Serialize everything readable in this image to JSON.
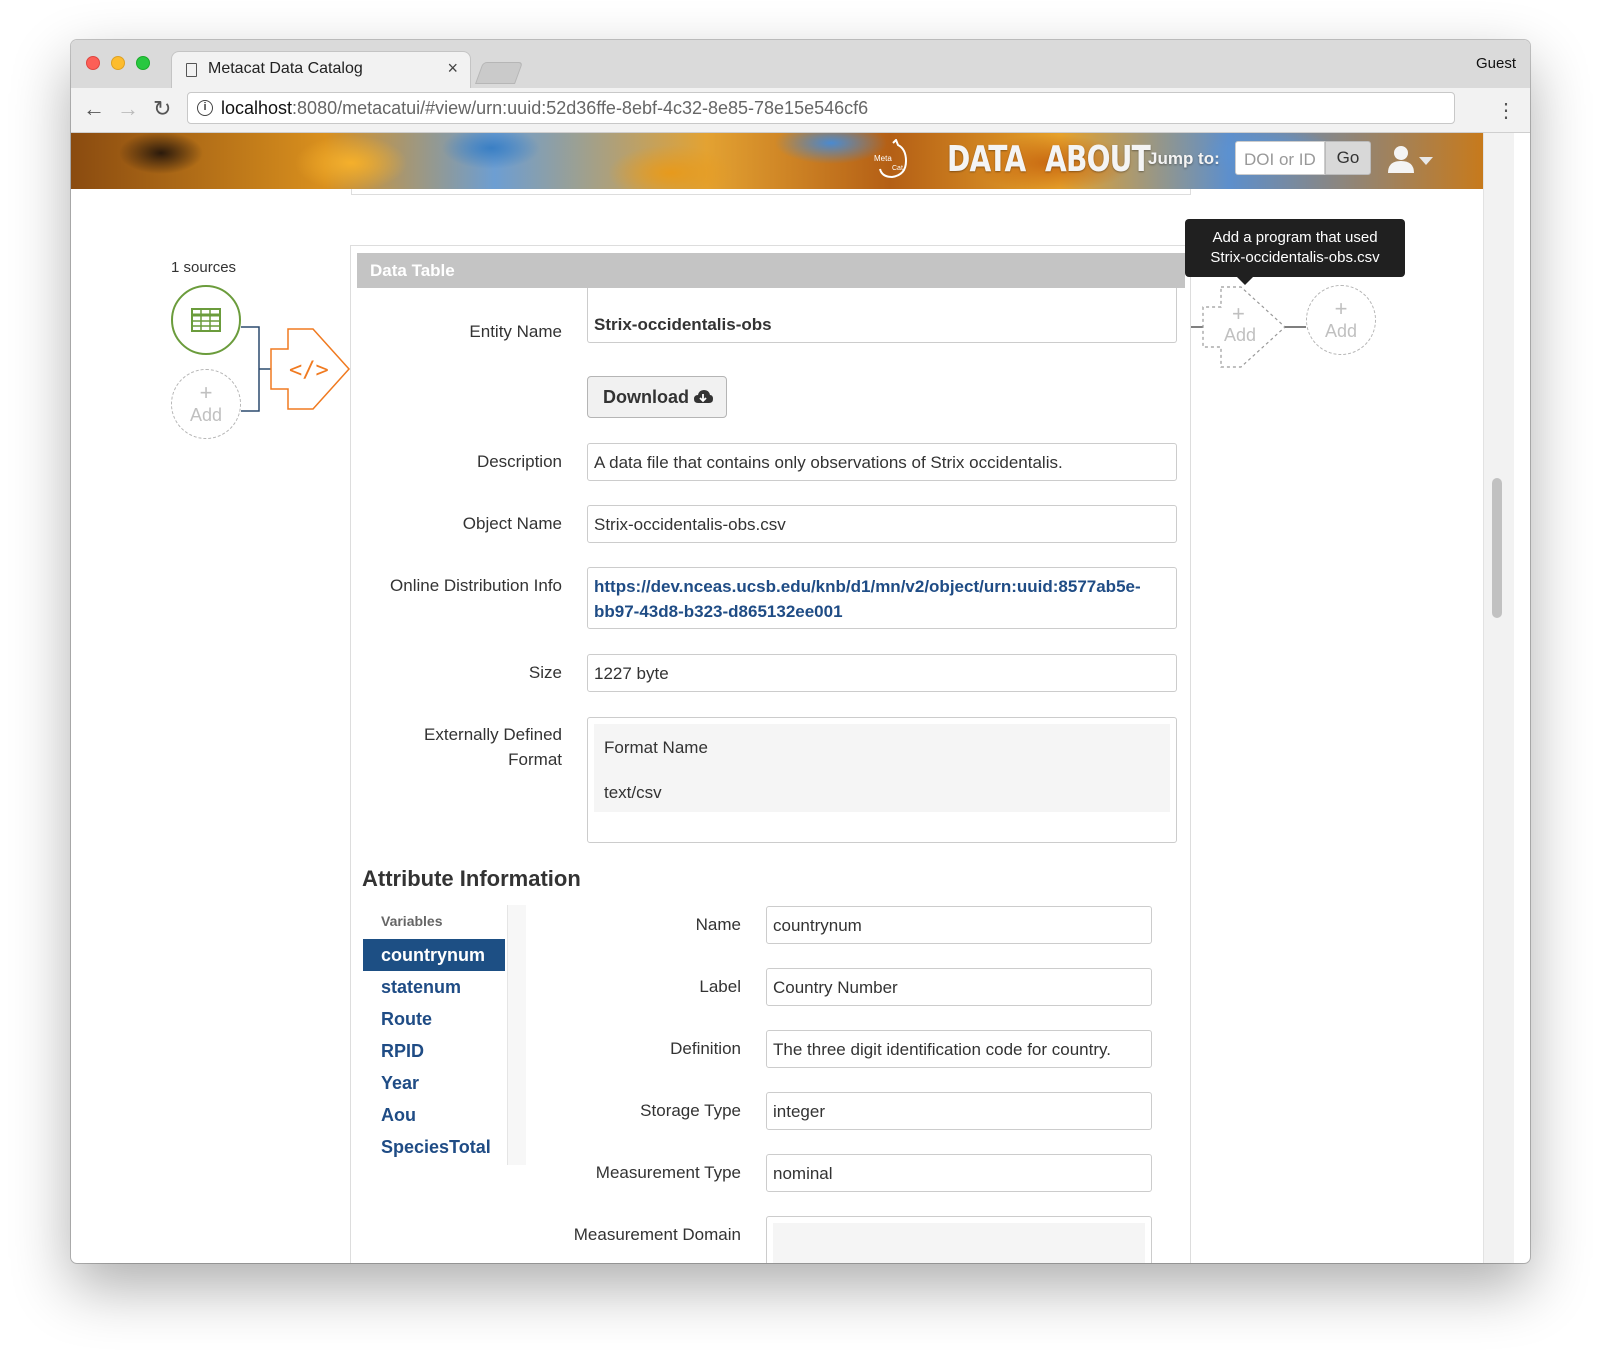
{
  "browser": {
    "tab_title": "Metacat Data Catalog",
    "tab_close": "×",
    "profile": "Guest",
    "url_host": "localhost",
    "url_rest": ":8080/metacatui/#view/urn:uuid:52d36ffe-8ebf-4c32-8e85-78e15e546cf6",
    "back": "←",
    "forward": "→",
    "reload": "↻",
    "menu": "⋮"
  },
  "header": {
    "logo_top": "Meta",
    "logo_bottom": "Cat",
    "nav": [
      "DATA",
      "ABOUT"
    ],
    "jump_label": "Jump to:",
    "jump_placeholder": "DOI or ID",
    "go_label": "Go"
  },
  "provenance": {
    "sources_label": "1 sources",
    "add_label": "Add",
    "add_plus": "+",
    "tooltip_line1": "Add a program that used",
    "tooltip_line2": "Strix-occidentalis-obs.csv",
    "program_glyph": "</>",
    "colors": {
      "source": "#6b9c3c",
      "program": "#f07a20"
    }
  },
  "data_table": {
    "header": "Data Table",
    "download_label": "Download",
    "fields": [
      {
        "label": "Entity Name",
        "value": "Strix-occidentalis-obs"
      },
      {
        "label": "Description",
        "value": "A data file that contains only observations of Strix occidentalis."
      },
      {
        "label": "Object Name",
        "value": "Strix-occidentalis-obs.csv"
      },
      {
        "label": "Online Distribution Info",
        "value_line1": "https://dev.nceas.ucsb.edu/knb/d1/mn/v2/object/urn:uuid:8577ab5e-",
        "value_line2": "bb97-43d8-b323-d865132ee001"
      },
      {
        "label": "Size",
        "value": "1227 byte"
      },
      {
        "label_line1": "Externally Defined",
        "label_line2": "Format",
        "format_name_label": "Format Name",
        "format_name_value": "text/csv"
      }
    ]
  },
  "attributes": {
    "heading": "Attribute Information",
    "variables_label": "Variables",
    "variables": [
      "countrynum",
      "statenum",
      "Route",
      "RPID",
      "Year",
      "Aou",
      "SpeciesTotal"
    ],
    "selected_variable": "countrynum",
    "fields": [
      {
        "label": "Name",
        "value": "countrynum"
      },
      {
        "label": "Label",
        "value": "Country Number"
      },
      {
        "label": "Definition",
        "value": "The three digit identification code for country."
      },
      {
        "label": "Storage Type",
        "value": "integer"
      },
      {
        "label": "Measurement Type",
        "value": "nominal"
      },
      {
        "label": "Measurement Domain",
        "value": ""
      }
    ]
  }
}
